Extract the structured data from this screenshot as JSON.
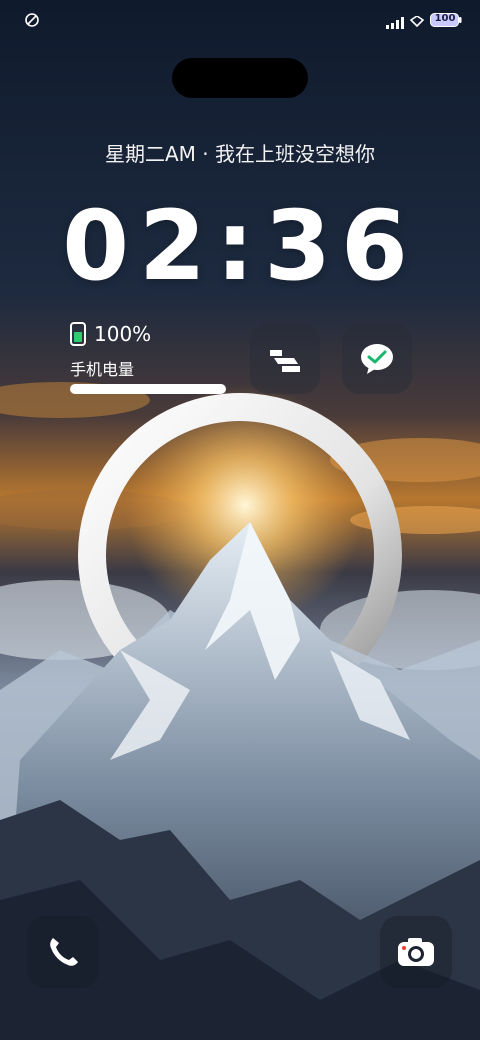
{
  "status_bar": {
    "battery_text": "100",
    "left_icon": "ring-icon",
    "signal_icon": "signal-icon",
    "wifi_icon": "wifi-icon"
  },
  "lockscreen": {
    "subtitle": "星期二AM · 我在上班没空想你",
    "time": "02:36"
  },
  "battery_widget": {
    "percent": "100%",
    "label": "手机电量",
    "level": 1.0
  },
  "shortcuts": [
    {
      "name": "folder-app-icon"
    },
    {
      "name": "wechat-icon"
    }
  ],
  "bottom_actions": {
    "left": "phone-icon",
    "right": "camera-icon"
  },
  "colors": {
    "accent": "#ffffff",
    "sky_top": "#0f1a2e",
    "sunset": "#f0a33a"
  }
}
